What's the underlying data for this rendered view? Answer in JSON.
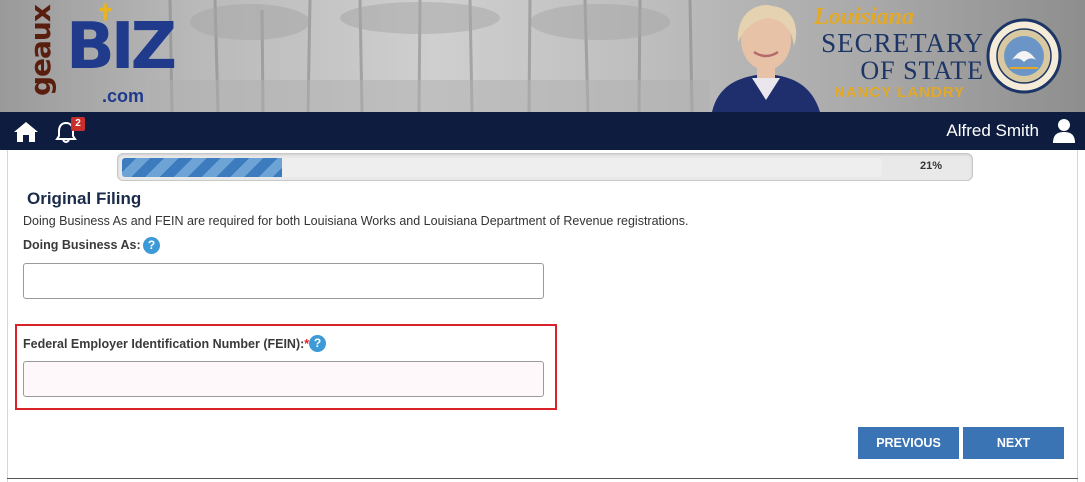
{
  "banner": {
    "logo": {
      "geaux": "geaux",
      "biz": "BIZ",
      "com": ".com"
    },
    "sos": {
      "state": "Louisiana",
      "line1": "SECRETARY",
      "line2": "OF STATE",
      "name": "NANCY LANDRY"
    },
    "seal_text": "STATE OF LOUISIANA · SECRETARY OF STATE"
  },
  "nav": {
    "notification_count": "2",
    "user_name": "Alfred Smith",
    "icons": [
      "home-icon",
      "bell-icon",
      "user-icon"
    ]
  },
  "progress": {
    "value": 21,
    "label": "21%"
  },
  "form": {
    "title": "Original Filing",
    "info": "Doing Business As and FEIN are required for both Louisiana Works and Louisiana Department of Revenue registrations.",
    "dba": {
      "label": "Doing Business As:",
      "value": "",
      "help": "?"
    },
    "fein": {
      "label": "Federal Employer Identification Number (FEIN):",
      "required_mark": "*",
      "value": "",
      "help": "?"
    }
  },
  "buttons": {
    "previous": "PREVIOUS",
    "next": "NEXT"
  },
  "colors": {
    "navbar": "#0e1d3f",
    "button": "#3a74b4",
    "help": "#3d9ad6",
    "highlight": "#d9222a",
    "sos_gold": "#e3a926",
    "sos_blue": "#1d3566"
  }
}
